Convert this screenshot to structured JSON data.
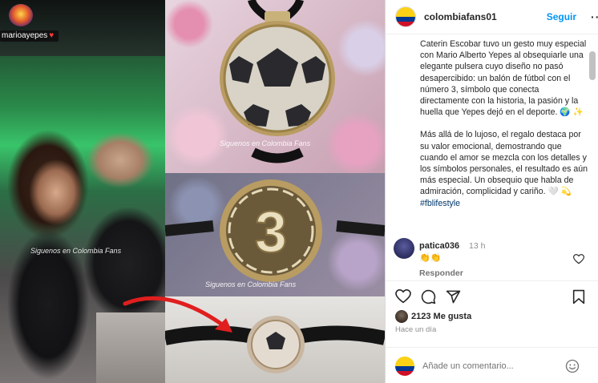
{
  "media": {
    "tag_label": "marioayepes",
    "watermark": "Siguenos en Colombia Fans"
  },
  "header": {
    "username": "colombiafans01",
    "follow_label": "Seguir",
    "more_label": "···"
  },
  "caption": {
    "paragraph1": "Caterin Escobar tuvo un gesto muy especial con Mario Alberto Yepes al obsequiarle una elegante pulsera cuyo diseño no pasó desapercibido: un balón de fútbol con el número 3, símbolo que conecta directamente con la historia, la pasión y la huella que Yepes dejó en el deporte. 🌍 ✨",
    "paragraph2": "Más allá de lo lujoso, el regalo destaca por su valor emocional, demostrando que cuando el amor se mezcla con los detalles y los símbolos personales, el resultado es aún más especial. Un obsequio que habla de admiración, complicidad y cariño. 🤍 💫",
    "hashtag": "#fblifestyle"
  },
  "comment": {
    "username": "patica036",
    "time": "13 h",
    "text": "👏👏",
    "reply_label": "Responder"
  },
  "actions": {
    "likes": "2123 Me gusta",
    "time_ago": "Hace un día"
  },
  "add_comment": {
    "placeholder": "Añade un comentario..."
  },
  "colors": {
    "accent": "#0095f6",
    "text": "#262626",
    "muted": "#8e8e8e"
  }
}
